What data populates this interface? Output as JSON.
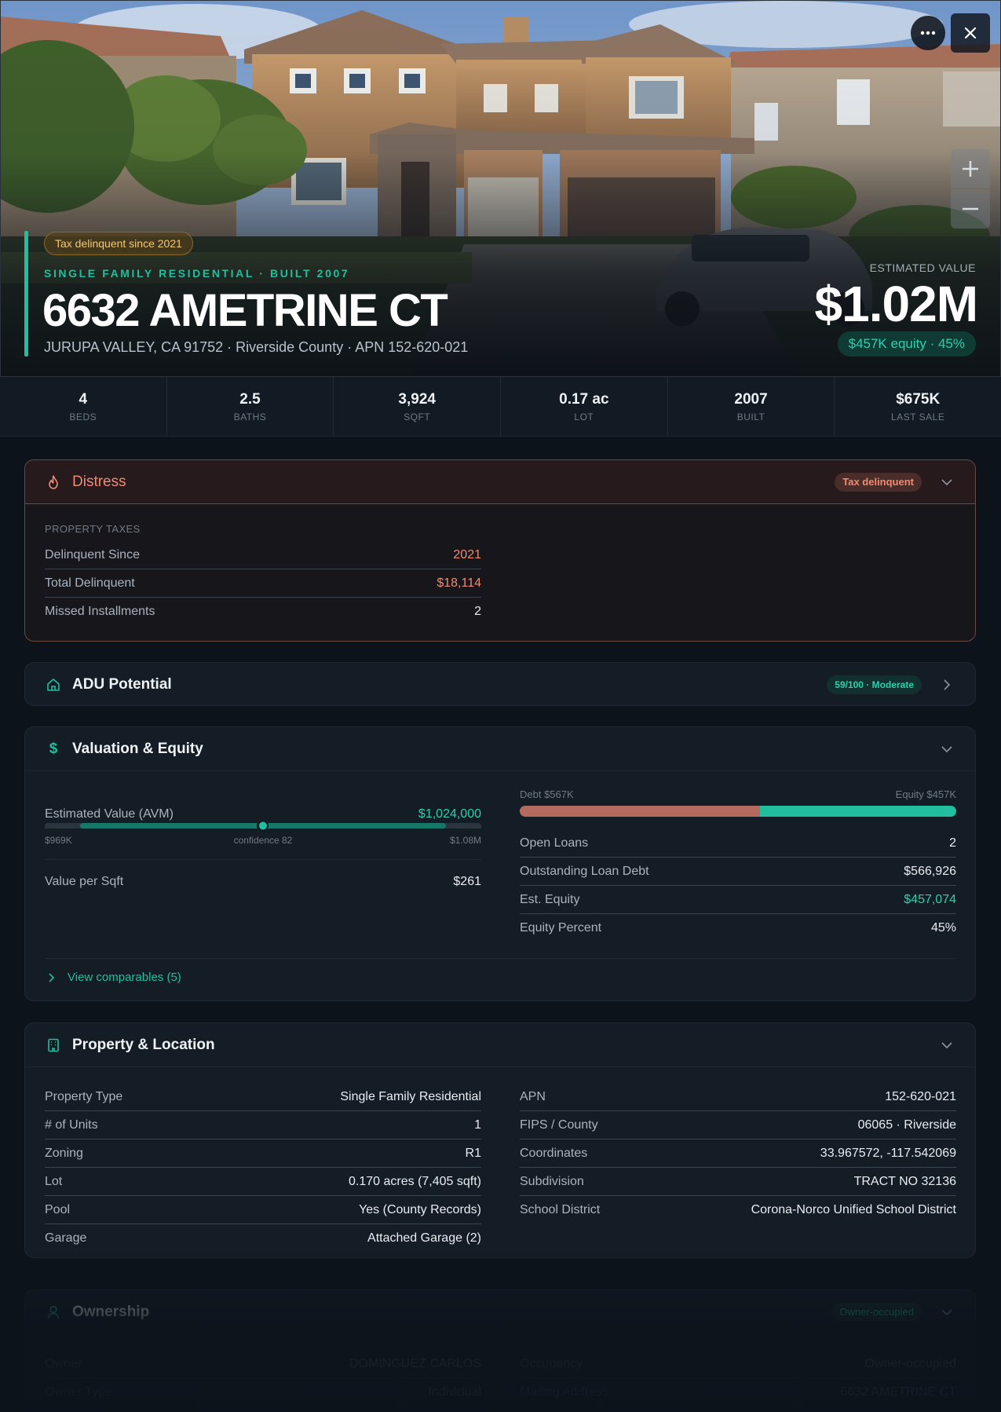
{
  "hero": {
    "badge": "Tax delinquent since 2021",
    "type_line": "SINGLE FAMILY RESIDENTIAL · BUILT 2007",
    "title": "6632 AMETRINE CT",
    "address": "JURUPA VALLEY, CA 91752 · Riverside County · APN 152-620-021",
    "est_label": "ESTIMATED VALUE",
    "est_value": "$1.02M",
    "equity_pill": "$457K equity · 45%",
    "icons": {
      "more": "more-horizontal-icon",
      "close": "close-icon",
      "zoom_in": "plus-icon",
      "zoom_out": "minus-icon"
    }
  },
  "stats": [
    {
      "value": "4",
      "label": "BEDS"
    },
    {
      "value": "2.5",
      "label": "BATHS"
    },
    {
      "value": "3,924",
      "label": "SQFT"
    },
    {
      "value": "0.17 ac",
      "label": "LOT"
    },
    {
      "value": "2007",
      "label": "BUILT"
    },
    {
      "value": "$675K",
      "label": "LAST SALE"
    }
  ],
  "distress": {
    "title": "Distress",
    "tag": "Tax delinquent",
    "section": "PROPERTY TAXES",
    "rows": [
      {
        "label": "Delinquent Since",
        "value": "2021"
      },
      {
        "label": "Total Delinquent",
        "value": "$18,114"
      },
      {
        "label": "Missed Installments",
        "value": "2"
      }
    ]
  },
  "adu": {
    "title": "ADU Potential",
    "tag": "59/100 · Moderate",
    "score": 59
  },
  "valuation": {
    "title": "Valuation & Equity",
    "avm_label": "Estimated Value (AVM)",
    "avm_value": "$1,024,000",
    "range_low": "$969K",
    "range_high": "$1.08M",
    "confidence": "confidence 82",
    "vps_label": "Value per Sqft",
    "vps_value": "$261",
    "debt_label": "Debt $567K",
    "equity_label": "Equity $457K",
    "equity_fraction": 0.45,
    "rows": [
      {
        "label": "Open Loans",
        "value": "2"
      },
      {
        "label": "Outstanding Loan Debt",
        "value": "$566,926"
      },
      {
        "label": "Est. Equity",
        "value": "$457,074"
      },
      {
        "label": "Equity Percent",
        "value": "45%"
      }
    ],
    "comps_link": "View comparables (5)"
  },
  "property": {
    "title": "Property & Location",
    "left": [
      {
        "label": "Property Type",
        "value": "Single Family Residential"
      },
      {
        "label": "# of Units",
        "value": "1"
      },
      {
        "label": "Zoning",
        "value": "R1"
      },
      {
        "label": "Lot",
        "value": "0.170 acres (7,405 sqft)"
      },
      {
        "label": "Pool",
        "value": "Yes (County Records)"
      },
      {
        "label": "Garage",
        "value": "Attached Garage (2)"
      }
    ],
    "right": [
      {
        "label": "APN",
        "value": "152-620-021"
      },
      {
        "label": "FIPS / County",
        "value": "06065 · Riverside"
      },
      {
        "label": "Coordinates",
        "value": "33.967572, -117.542069"
      },
      {
        "label": "Subdivision",
        "value": "TRACT NO 32136"
      },
      {
        "label": "School District",
        "value": "Corona-Norco Unified School District"
      }
    ]
  },
  "ownership": {
    "title": "Ownership",
    "tag": "Owner-occupied",
    "left": [
      {
        "label": "Owner",
        "value": "DOMINGUEZ CARLOS"
      },
      {
        "label": "Owner Type",
        "value": "Individual"
      }
    ],
    "right": [
      {
        "label": "Occupancy",
        "value": "Owner-occupied"
      },
      {
        "label": "Mailing Address",
        "value": "6632 AMETRINE CT"
      }
    ]
  },
  "colors": {
    "accent": "#1fbf9f",
    "distress": "#f08a73",
    "debt": "#b46a5e",
    "equity": "#1fbf9f",
    "background": "#0d131b"
  }
}
